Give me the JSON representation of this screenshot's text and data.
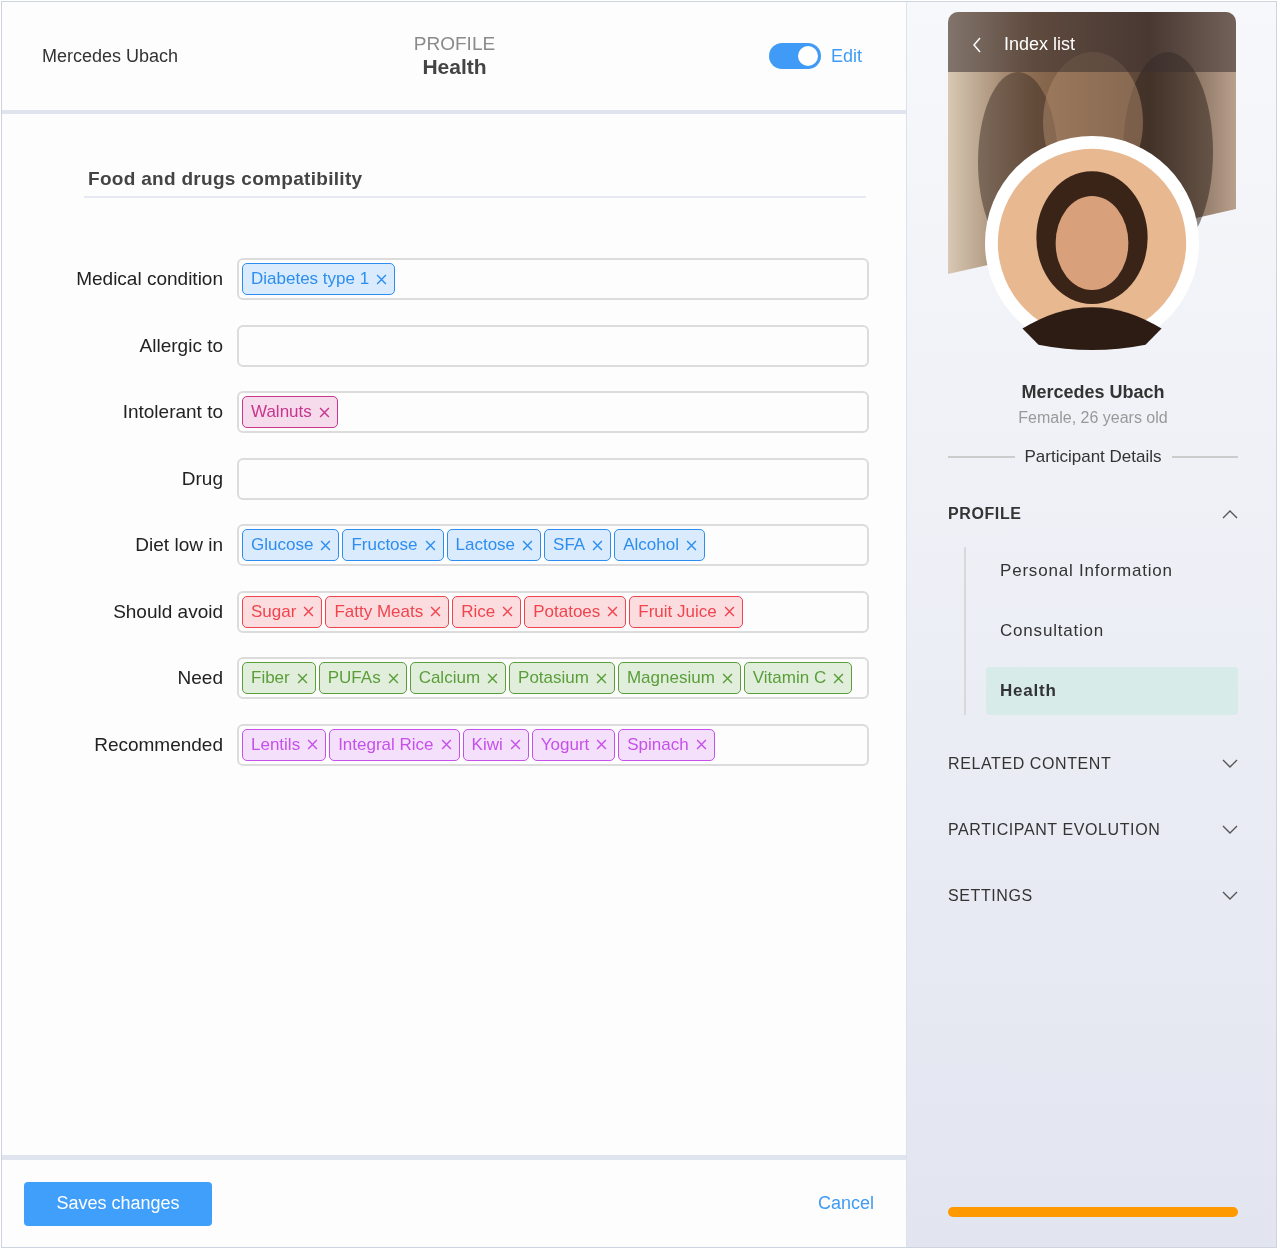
{
  "header": {
    "user_name": "Mercedes Ubach",
    "section": "PROFILE",
    "page": "Health",
    "edit_toggle": {
      "on": true,
      "label": "Edit"
    }
  },
  "form": {
    "title": "Food and drugs compatibility",
    "fields": [
      {
        "label": "Medical condition",
        "color": "#2e8ef0",
        "tags": [
          "Diabetes type 1"
        ]
      },
      {
        "label": "Allergic to"
      },
      {
        "label": "Intolerant to",
        "color": "#c8368e",
        "tags": [
          "Walnuts"
        ]
      },
      {
        "label": "Drug"
      },
      {
        "label": "Diet low in",
        "color": "#2e8ef0",
        "tags": [
          "Glucose",
          "Fructose",
          "Lactose",
          "SFA",
          "Alcohol"
        ]
      },
      {
        "label": "Should avoid",
        "color": "#f0444f",
        "tags": [
          "Sugar",
          "Fatty Meats",
          "Rice",
          "Potatoes",
          "Fruit Juice"
        ]
      },
      {
        "label": "Need",
        "color": "#5a9e3a",
        "tags": [
          "Fiber",
          "PUFAs",
          "Calcium",
          "Potasium",
          "Magnesium",
          "Vitamin C"
        ]
      },
      {
        "label": "Recommended",
        "color": "#c650ea",
        "tags": [
          "Lentils",
          "Integral Rice",
          "Kiwi",
          "Yogurt",
          "Spinach"
        ]
      }
    ]
  },
  "footer": {
    "save_button": "Saves changes",
    "cancel_link": "Cancel"
  },
  "sidebar": {
    "back_label": "Index list",
    "name": "Mercedes Ubach",
    "subtitle": "Female, 26 years old",
    "details_heading": "Participant Details",
    "sections": [
      {
        "title": "PROFILE",
        "expanded": true,
        "items": [
          {
            "label": "Personal Information",
            "selected": false
          },
          {
            "label": "Consultation",
            "selected": false
          },
          {
            "label": "Health",
            "selected": true
          }
        ]
      },
      {
        "title": "RELATED CONTENT",
        "expanded": false
      },
      {
        "title": "PARTICIPANT EVOLUTION",
        "expanded": false
      },
      {
        "title": "SETTINGS",
        "expanded": false
      }
    ]
  }
}
